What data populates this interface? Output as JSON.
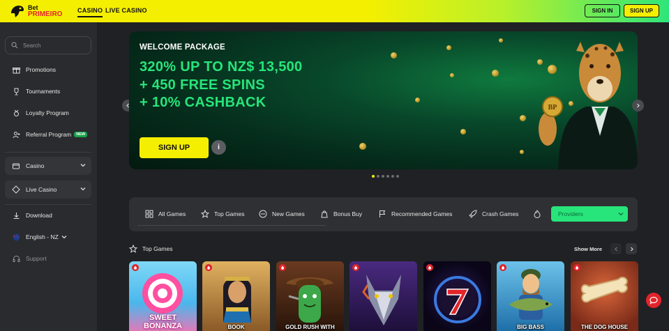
{
  "header": {
    "logo_line1": "Bet",
    "logo_line2": "PRIMEIRO",
    "nav": [
      "CASINO",
      "LIVE CASINO"
    ],
    "signin_label": "SIGN IN",
    "signup_label": "SIGN UP"
  },
  "sidebar": {
    "search_placeholder": "Search",
    "items": [
      {
        "label": "Promotions",
        "icon": "gift-icon"
      },
      {
        "label": "Tournaments",
        "icon": "trophy-icon"
      },
      {
        "label": "Loyalty Program",
        "icon": "medal-icon"
      },
      {
        "label": "Referral Program",
        "icon": "user-plus-icon",
        "badge": "NEW"
      }
    ],
    "sections": [
      {
        "label": "Casino",
        "icon": "casino-icon"
      },
      {
        "label": "Live Casino",
        "icon": "live-icon"
      }
    ],
    "download_label": "Download",
    "language_label": "English - NZ",
    "support_label": "Support"
  },
  "banner": {
    "title": "WELCOME PACKAGE",
    "lines": [
      "320% UP TO NZ$ 13,500",
      "+ 450 FREE SPINS",
      "+ 10% CASHBACK"
    ],
    "cta_label": "SIGN UP",
    "info_label": "i",
    "coin_label": "BP",
    "slides_total": 6,
    "slide_active": 1
  },
  "categories": {
    "items": [
      {
        "label": "All Games",
        "icon": "grid-icon"
      },
      {
        "label": "Top Games",
        "icon": "star-icon"
      },
      {
        "label": "New Games",
        "icon": "new-icon"
      },
      {
        "label": "Bonus Buy",
        "icon": "bag-icon"
      },
      {
        "label": "Recommended Games",
        "icon": "flag-icon"
      },
      {
        "label": "Crash Games",
        "icon": "rocket-icon"
      },
      {
        "label": "",
        "icon": "fire-icon"
      }
    ],
    "providers_label": "Providers"
  },
  "games_section": {
    "title": "Top Games",
    "show_more_label": "Show More",
    "games": [
      {
        "name": "SWEET BONANZA",
        "bg": "#5fc7f0"
      },
      {
        "name": "BOOK",
        "bg": "#c68a3d"
      },
      {
        "name": "GOLD RUSH WITH",
        "bg": "#4b2a18"
      },
      {
        "name": "",
        "bg": "#3a2060"
      },
      {
        "name": "",
        "bg": "#140c2c"
      },
      {
        "name": "BIG BASS",
        "bg": "#1f7fb5"
      },
      {
        "name": "THE DOG HOUSE",
        "bg": "#a8452a"
      }
    ]
  },
  "colors": {
    "accent_yellow": "#f4ef00",
    "accent_green": "#27e57a",
    "brand_red": "#e3242b"
  }
}
